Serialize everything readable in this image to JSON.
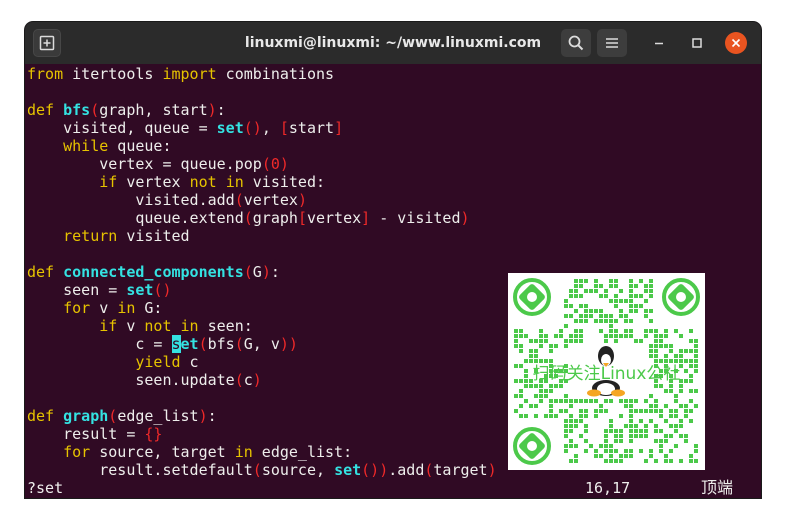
{
  "window": {
    "title": "linuxmi@linuxmi: ~/www.linuxmi.com"
  },
  "icons": {
    "new_tab": "new-tab-icon",
    "search": "search-icon",
    "menu": "hamburger-menu-icon",
    "minimize": "minimize-icon",
    "maximize": "maximize-icon",
    "close": "close-icon"
  },
  "colors": {
    "terminal_bg": "#300a24",
    "titlebar_bg": "#2b2b2b",
    "keyword": "#e6c300",
    "function_name": "#34e2e2",
    "bracket": "#ef2929",
    "text": "#eeeeec",
    "close_button": "#e95420",
    "qr_green": "#4cc94a"
  },
  "editor": {
    "lines": [
      [
        {
          "t": "from",
          "c": "kw"
        },
        {
          "t": " itertools "
        },
        {
          "t": "import",
          "c": "kw"
        },
        {
          "t": " combinations"
        }
      ],
      [],
      [
        {
          "t": "def",
          "c": "kw"
        },
        {
          "t": " "
        },
        {
          "t": "bfs",
          "c": "fn"
        },
        {
          "t": "(",
          "c": "pr"
        },
        {
          "t": "graph, start"
        },
        {
          "t": ")",
          "c": "pr"
        },
        {
          "t": ":"
        }
      ],
      [
        {
          "t": "    visited, queue = "
        },
        {
          "t": "set",
          "c": "fn"
        },
        {
          "t": "()",
          "c": "pr"
        },
        {
          "t": ", "
        },
        {
          "t": "[",
          "c": "pr"
        },
        {
          "t": "start"
        },
        {
          "t": "]",
          "c": "pr"
        }
      ],
      [
        {
          "t": "    "
        },
        {
          "t": "while",
          "c": "kw"
        },
        {
          "t": " queue:"
        }
      ],
      [
        {
          "t": "        vertex = queue.pop"
        },
        {
          "t": "(",
          "c": "pr"
        },
        {
          "t": "0",
          "c": "nm"
        },
        {
          "t": ")",
          "c": "pr"
        }
      ],
      [
        {
          "t": "        "
        },
        {
          "t": "if",
          "c": "kw"
        },
        {
          "t": " vertex "
        },
        {
          "t": "not",
          "c": "kw"
        },
        {
          "t": " "
        },
        {
          "t": "in",
          "c": "kw"
        },
        {
          "t": " visited:"
        }
      ],
      [
        {
          "t": "            visited.add"
        },
        {
          "t": "(",
          "c": "pr"
        },
        {
          "t": "vertex"
        },
        {
          "t": ")",
          "c": "pr"
        }
      ],
      [
        {
          "t": "            queue.extend"
        },
        {
          "t": "(",
          "c": "pr"
        },
        {
          "t": "graph"
        },
        {
          "t": "[",
          "c": "pr"
        },
        {
          "t": "vertex"
        },
        {
          "t": "]",
          "c": "pr"
        },
        {
          "t": " - visited"
        },
        {
          "t": ")",
          "c": "pr"
        }
      ],
      [
        {
          "t": "    "
        },
        {
          "t": "return",
          "c": "kw"
        },
        {
          "t": " visited"
        }
      ],
      [],
      [
        {
          "t": "def",
          "c": "kw"
        },
        {
          "t": " "
        },
        {
          "t": "connected_components",
          "c": "fn"
        },
        {
          "t": "(",
          "c": "pr"
        },
        {
          "t": "G"
        },
        {
          "t": ")",
          "c": "pr"
        },
        {
          "t": ":"
        }
      ],
      [
        {
          "t": "    seen = "
        },
        {
          "t": "set",
          "c": "fn"
        },
        {
          "t": "()",
          "c": "pr"
        }
      ],
      [
        {
          "t": "    "
        },
        {
          "t": "for",
          "c": "kw"
        },
        {
          "t": " v "
        },
        {
          "t": "in",
          "c": "kw"
        },
        {
          "t": " G:"
        }
      ],
      [
        {
          "t": "        "
        },
        {
          "t": "if",
          "c": "kw"
        },
        {
          "t": " v "
        },
        {
          "t": "not",
          "c": "kw"
        },
        {
          "t": " "
        },
        {
          "t": "in",
          "c": "kw"
        },
        {
          "t": " seen:"
        }
      ],
      [
        {
          "t": "            c = "
        },
        {
          "t": "s",
          "c": "cursor"
        },
        {
          "t": "et",
          "c": "fn"
        },
        {
          "t": "(",
          "c": "pr"
        },
        {
          "t": "bfs"
        },
        {
          "t": "(",
          "c": "pr"
        },
        {
          "t": "G, v"
        },
        {
          "t": "))",
          "c": "pr"
        }
      ],
      [
        {
          "t": "            "
        },
        {
          "t": "yield",
          "c": "kw"
        },
        {
          "t": " c"
        }
      ],
      [
        {
          "t": "            seen.update"
        },
        {
          "t": "(",
          "c": "pr"
        },
        {
          "t": "c"
        },
        {
          "t": ")",
          "c": "pr"
        }
      ],
      [],
      [
        {
          "t": "def",
          "c": "kw"
        },
        {
          "t": " "
        },
        {
          "t": "graph",
          "c": "fn"
        },
        {
          "t": "(",
          "c": "pr"
        },
        {
          "t": "edge_list"
        },
        {
          "t": ")",
          "c": "pr"
        },
        {
          "t": ":"
        }
      ],
      [
        {
          "t": "    result = "
        },
        {
          "t": "{}",
          "c": "pr"
        }
      ],
      [
        {
          "t": "    "
        },
        {
          "t": "for",
          "c": "kw"
        },
        {
          "t": " source, target "
        },
        {
          "t": "in",
          "c": "kw"
        },
        {
          "t": " edge_list:"
        }
      ],
      [
        {
          "t": "        result.setdefault"
        },
        {
          "t": "(",
          "c": "pr"
        },
        {
          "t": "source, "
        },
        {
          "t": "set",
          "c": "fn"
        },
        {
          "t": "())",
          "c": "pr"
        },
        {
          "t": ".add"
        },
        {
          "t": "(",
          "c": "pr"
        },
        {
          "t": "target"
        },
        {
          "t": ")",
          "c": "pr"
        }
      ]
    ]
  },
  "status": {
    "command": "?set",
    "cursor_position": "16,17",
    "scroll_position": "顶端"
  },
  "overlay": {
    "qr_caption": "扫码关注Linux公社"
  }
}
